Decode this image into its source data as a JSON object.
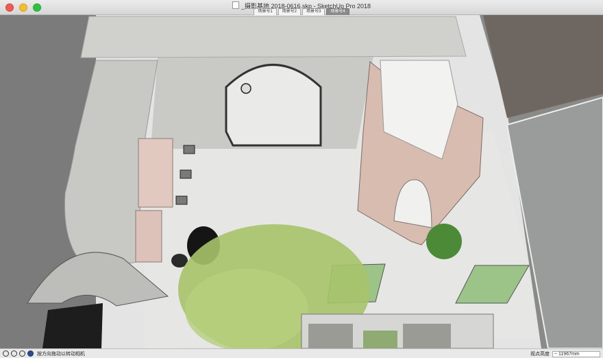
{
  "window": {
    "title": "_摄影基地 2018-0616.skp - SketchUp Pro 2018",
    "scene_tabs": [
      {
        "label": "场景号1",
        "active": false
      },
      {
        "label": "场景号2",
        "active": false
      },
      {
        "label": "场景号3",
        "active": false
      },
      {
        "label": "场景号4",
        "active": true
      }
    ]
  },
  "status": {
    "message": "按方向拖动以转动相机",
    "measurement_label": "视点高度",
    "measurement_value": "~ 11967mm"
  },
  "viewport": {
    "content": "3D aerial view of courtyard model",
    "colors": {
      "concrete": "#cfcfcc",
      "floor": "#e5e5e3",
      "pink_wall": "#d6b8ac",
      "green_mat": "#9cc489",
      "deck": "#6e6660",
      "foliage": "#a7c36a"
    }
  }
}
